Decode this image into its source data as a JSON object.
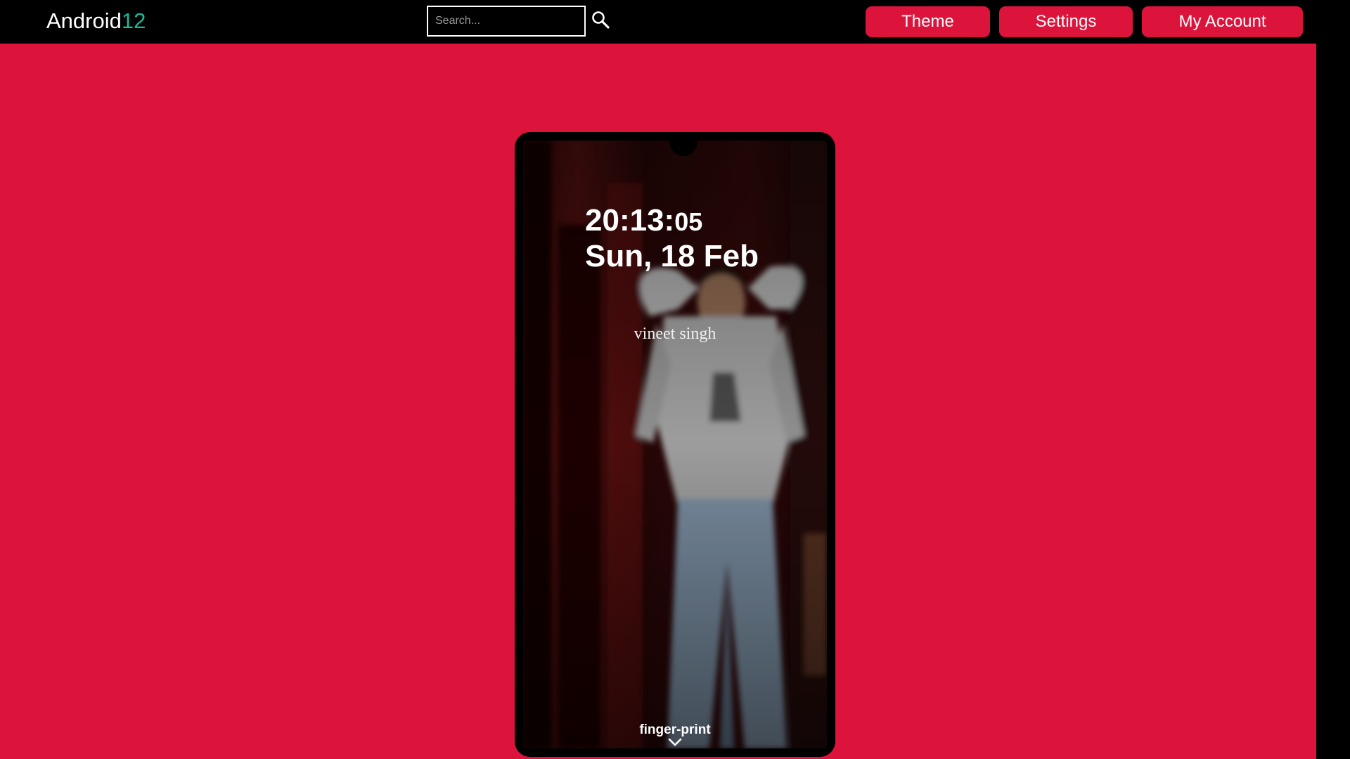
{
  "header": {
    "brand_text": "Android",
    "brand_accent": "12",
    "brand_accent_color": "#1fb89a",
    "search": {
      "placeholder": "Search...",
      "value": "",
      "icon": "search-icon"
    },
    "nav": [
      {
        "label": "Theme"
      },
      {
        "label": "Settings"
      },
      {
        "label": "My Account"
      }
    ]
  },
  "colors": {
    "background": "#dc143c",
    "button": "#dc143c",
    "header": "#000000"
  },
  "lockscreen": {
    "time_hm": "20:13:",
    "time_s": "05",
    "date": "Sun, 18 Feb",
    "owner": "vineet singh",
    "unlock_label": "finger-print",
    "unlock_icon": "chevron-down-icon",
    "wallpaper": "photo-wallpaper"
  }
}
